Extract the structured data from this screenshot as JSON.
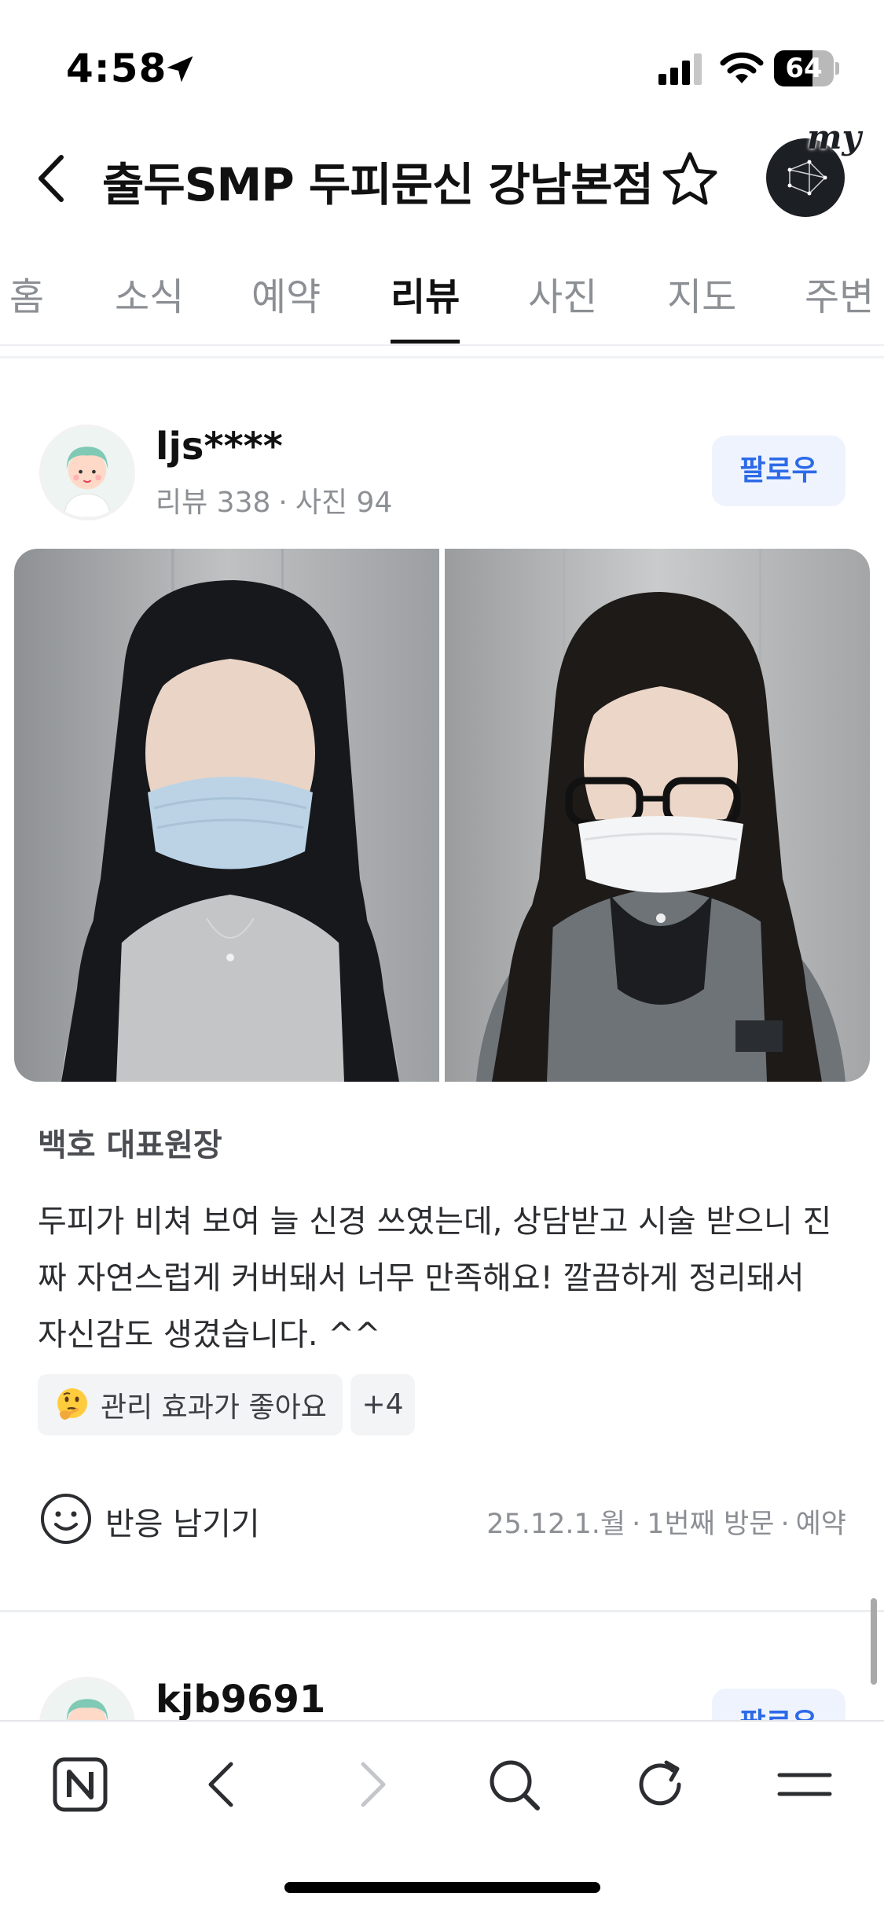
{
  "status_bar": {
    "time": "4:58",
    "battery": "64",
    "battery_level": 0.64
  },
  "header": {
    "title": "출두SMP 두피문신 강남본점",
    "my_label": "my"
  },
  "tabs": [
    {
      "label": "홈",
      "active": false
    },
    {
      "label": "소식",
      "active": false
    },
    {
      "label": "예약",
      "active": false
    },
    {
      "label": "리뷰",
      "active": true
    },
    {
      "label": "사진",
      "active": false
    },
    {
      "label": "지도",
      "active": false
    },
    {
      "label": "주변",
      "active": false
    }
  ],
  "review": {
    "reviewer_name": "ljs****",
    "reviews_label": "리뷰 338",
    "separator": "·",
    "photos_label": "사진 94",
    "follow_label": "팔로우",
    "menu_name": "백호 대표원장",
    "text_lines": [
      "두피가 비쳐 보여 늘 신경 쓰였는데, 상담받고 시술 받으니 진",
      "짜 자연스럽게 커버돼서 너무 만족해요! 깔끔하게 정리돼서",
      "자신감도 생겼습니다. ^^"
    ],
    "tag_label": "관리 효과가 좋아요",
    "tag_emoji": "thinking-face-icon",
    "tag_more": "+4",
    "react_label": "반응 남기기",
    "visit_date": "25.12.1.월",
    "visit_count": "1번째 방문",
    "visit_type": "예약"
  },
  "next_review": {
    "reviewer_name": "kjb9691",
    "follow_label": "팔로우"
  },
  "toolbar": {
    "icons": [
      "naver-n-icon",
      "back-arrow-icon",
      "forward-arrow-icon",
      "search-icon",
      "reload-icon",
      "menu-icon"
    ]
  },
  "colors": {
    "accent": "#2c6ae8",
    "follow_bg": "#eef3fd",
    "muted_text": "#8c8f94"
  }
}
